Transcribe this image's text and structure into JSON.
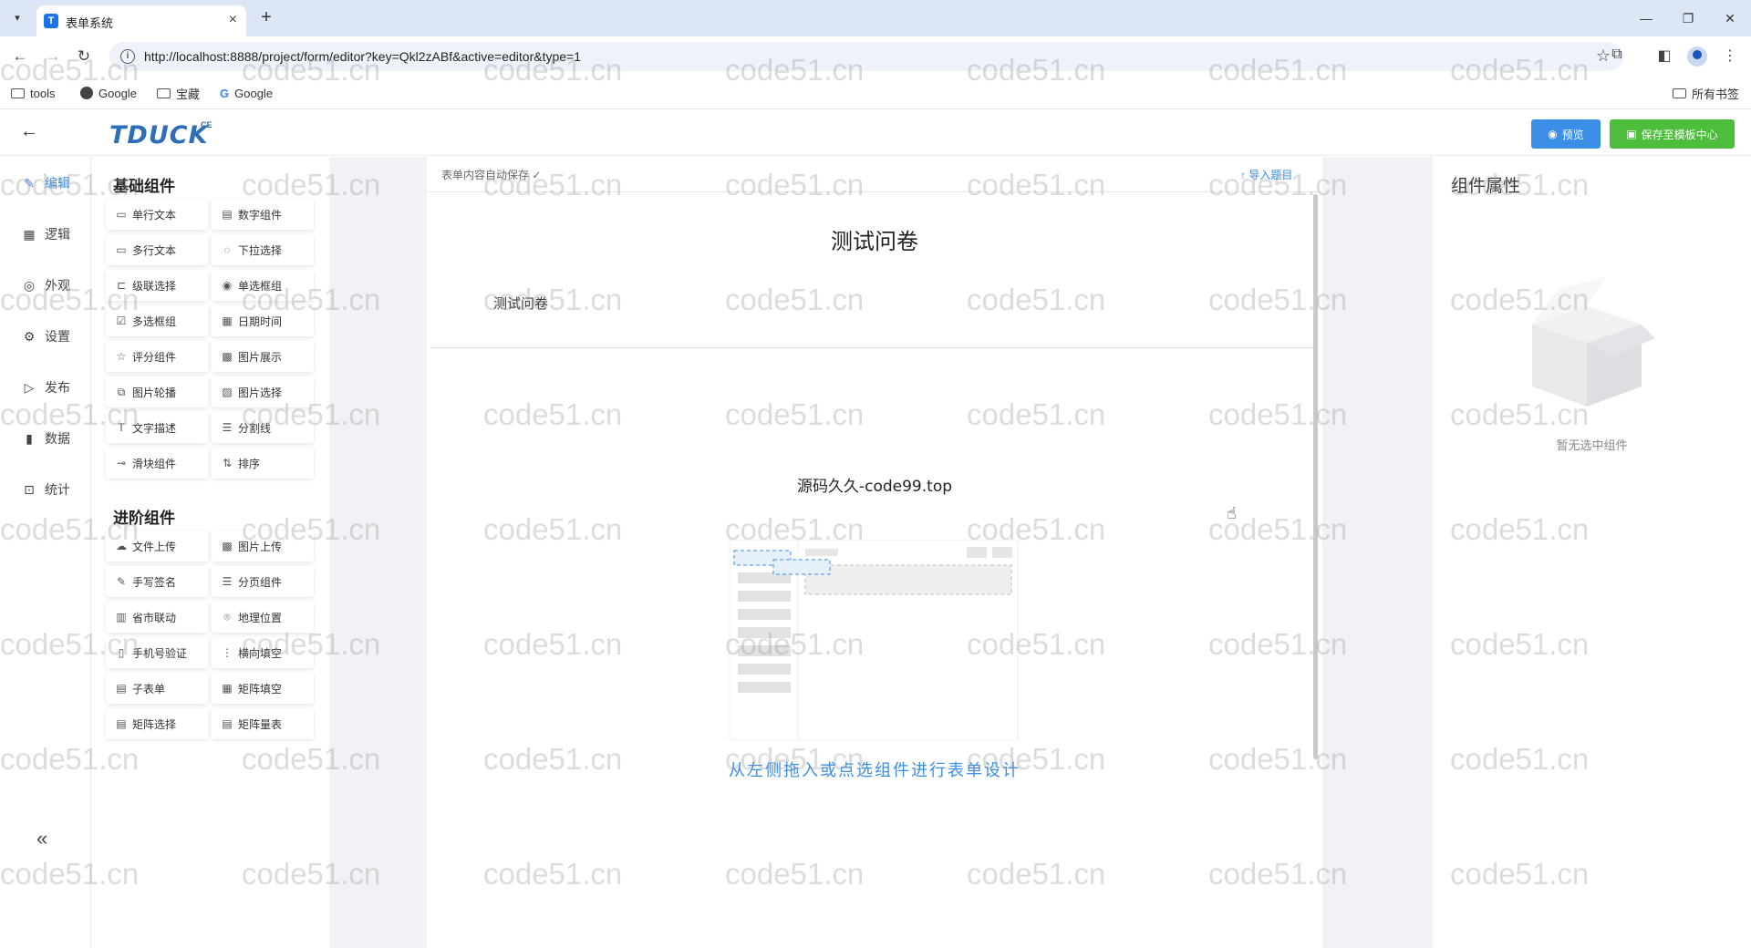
{
  "browser": {
    "tab_title": "表单系统",
    "tab_favicon": "T",
    "url": "http://localhost:8888/project/form/editor?key=Qkl2zABf&active=editor&type=1",
    "bookmarks": [
      {
        "label": "tools",
        "icon": "folder-icon"
      },
      {
        "label": "Google",
        "icon": "globe-icon"
      },
      {
        "label": "宝藏",
        "icon": "folder-icon"
      },
      {
        "label": "Google",
        "icon": "google-icon"
      }
    ],
    "all_bookmarks": "所有书签"
  },
  "header": {
    "logo": "TDUCK",
    "logo_sup": "CE",
    "preview_label": "预览",
    "save_label": "保存至模板中心"
  },
  "left_nav": {
    "items": [
      {
        "label": "编辑",
        "icon": "edit-icon",
        "active": true
      },
      {
        "label": "逻辑",
        "icon": "grid-icon"
      },
      {
        "label": "外观",
        "icon": "eye-icon"
      },
      {
        "label": "设置",
        "icon": "gear-icon"
      },
      {
        "label": "发布",
        "icon": "play-icon"
      },
      {
        "label": "数据",
        "icon": "bar-chart-icon"
      },
      {
        "label": "统计",
        "icon": "stats-icon"
      }
    ]
  },
  "palette": {
    "basic_title": "基础组件",
    "basic": [
      {
        "label": "单行文本",
        "icon": "input-icon"
      },
      {
        "label": "数字组件",
        "icon": "number-icon"
      },
      {
        "label": "多行文本",
        "icon": "textarea-icon"
      },
      {
        "label": "下拉选择",
        "icon": "dropdown-icon"
      },
      {
        "label": "级联选择",
        "icon": "cascade-icon"
      },
      {
        "label": "单选框组",
        "icon": "radio-icon"
      },
      {
        "label": "多选框组",
        "icon": "checkbox-icon"
      },
      {
        "label": "日期时间",
        "icon": "calendar-icon"
      },
      {
        "label": "评分组件",
        "icon": "star-icon"
      },
      {
        "label": "图片展示",
        "icon": "image-icon"
      },
      {
        "label": "图片轮播",
        "icon": "carousel-icon"
      },
      {
        "label": "图片选择",
        "icon": "image-select-icon"
      },
      {
        "label": "文字描述",
        "icon": "text-icon"
      },
      {
        "label": "分割线",
        "icon": "divider-icon"
      },
      {
        "label": "滑块组件",
        "icon": "slider-icon"
      },
      {
        "label": "排序",
        "icon": "sort-icon"
      }
    ],
    "advanced_title": "进阶组件",
    "advanced": [
      {
        "label": "文件上传",
        "icon": "upload-icon"
      },
      {
        "label": "图片上传",
        "icon": "image-upload-icon"
      },
      {
        "label": "手写签名",
        "icon": "signature-icon"
      },
      {
        "label": "分页组件",
        "icon": "pagination-icon"
      },
      {
        "label": "省市联动",
        "icon": "region-icon"
      },
      {
        "label": "地理位置",
        "icon": "location-icon"
      },
      {
        "label": "手机号验证",
        "icon": "phone-icon"
      },
      {
        "label": "横向填空",
        "icon": "fill-blank-icon"
      },
      {
        "label": "子表单",
        "icon": "subform-icon"
      },
      {
        "label": "矩阵填空",
        "icon": "matrix-fill-icon"
      },
      {
        "label": "矩阵选择",
        "icon": "matrix-select-icon"
      },
      {
        "label": "矩阵量表",
        "icon": "matrix-scale-icon"
      }
    ]
  },
  "canvas": {
    "autosave": "表单内容自动保存 ✓",
    "import": "导入题目",
    "form_title": "测试问卷",
    "form_description": "测试问卷",
    "brand_line": "源码久久-code99.top",
    "hint": "从左侧拖入或点选组件进行表单设计"
  },
  "properties": {
    "title": "组件属性",
    "empty_text": "暂无选中组件"
  },
  "watermark": "code51.cn",
  "colors": {
    "primary": "#3a8ee6",
    "success": "#4cbe3c",
    "logo": "#2c6fb7",
    "canvas_bg": "#f1f2f5"
  }
}
